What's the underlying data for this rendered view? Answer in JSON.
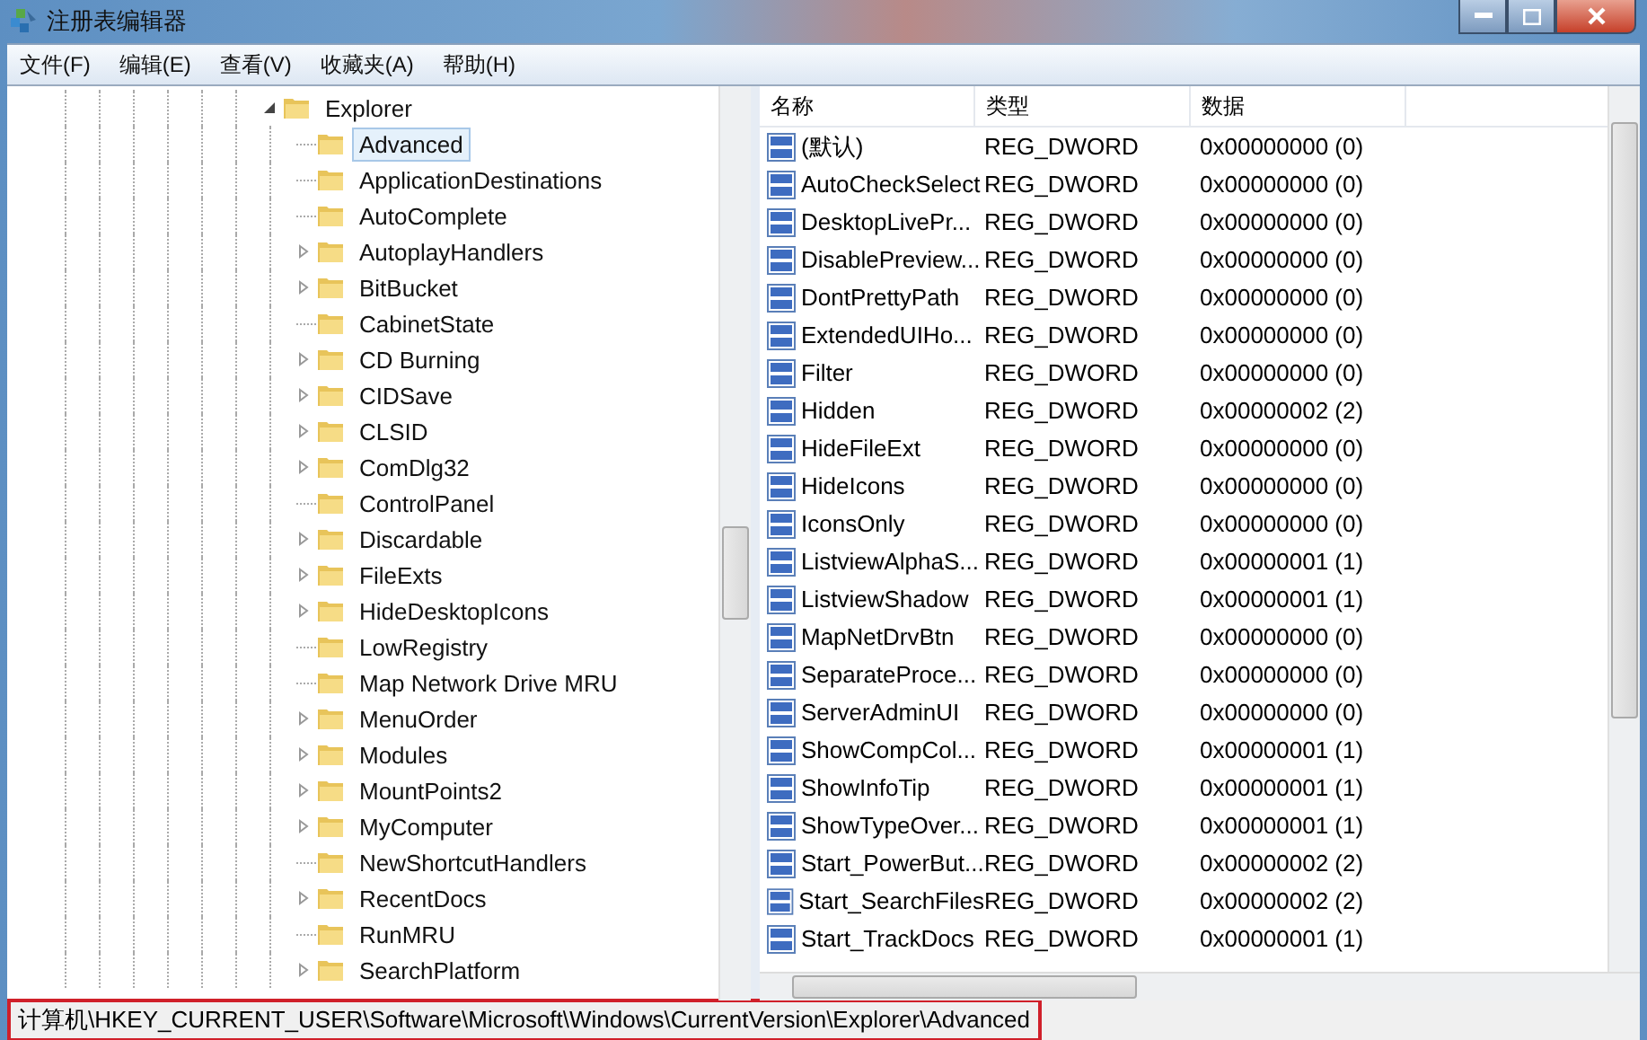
{
  "window": {
    "title": "注册表编辑器"
  },
  "menu": [
    "文件(F)",
    "编辑(E)",
    "查看(V)",
    "收藏夹(A)",
    "帮助(H)"
  ],
  "tree": [
    {
      "label": "Explorer",
      "expandable": true,
      "expanded": true,
      "selected": false,
      "children": [
        {
          "label": "Advanced",
          "expandable": false,
          "selected": true
        },
        {
          "label": "ApplicationDestinations",
          "expandable": false,
          "selected": false
        },
        {
          "label": "AutoComplete",
          "expandable": false,
          "selected": false
        },
        {
          "label": "AutoplayHandlers",
          "expandable": true,
          "selected": false
        },
        {
          "label": "BitBucket",
          "expandable": true,
          "selected": false
        },
        {
          "label": "CabinetState",
          "expandable": false,
          "selected": false
        },
        {
          "label": "CD Burning",
          "expandable": true,
          "selected": false
        },
        {
          "label": "CIDSave",
          "expandable": true,
          "selected": false
        },
        {
          "label": "CLSID",
          "expandable": true,
          "selected": false
        },
        {
          "label": "ComDlg32",
          "expandable": true,
          "selected": false
        },
        {
          "label": "ControlPanel",
          "expandable": false,
          "selected": false
        },
        {
          "label": "Discardable",
          "expandable": true,
          "selected": false
        },
        {
          "label": "FileExts",
          "expandable": true,
          "selected": false
        },
        {
          "label": "HideDesktopIcons",
          "expandable": true,
          "selected": false
        },
        {
          "label": "LowRegistry",
          "expandable": false,
          "selected": false
        },
        {
          "label": "Map Network Drive MRU",
          "expandable": false,
          "selected": false
        },
        {
          "label": "MenuOrder",
          "expandable": true,
          "selected": false
        },
        {
          "label": "Modules",
          "expandable": true,
          "selected": false
        },
        {
          "label": "MountPoints2",
          "expandable": true,
          "selected": false
        },
        {
          "label": "MyComputer",
          "expandable": true,
          "selected": false
        },
        {
          "label": "NewShortcutHandlers",
          "expandable": false,
          "selected": false
        },
        {
          "label": "RecentDocs",
          "expandable": true,
          "selected": false
        },
        {
          "label": "RunMRU",
          "expandable": false,
          "selected": false
        },
        {
          "label": "SearchPlatform",
          "expandable": true,
          "selected": false
        }
      ]
    }
  ],
  "table": {
    "columns": [
      "名称",
      "类型",
      "数据"
    ],
    "rows": [
      [
        "(默认)",
        "REG_DWORD",
        "0x00000000 (0)"
      ],
      [
        "AutoCheckSelect",
        "REG_DWORD",
        "0x00000000 (0)"
      ],
      [
        "DesktopLivePr...",
        "REG_DWORD",
        "0x00000000 (0)"
      ],
      [
        "DisablePreview...",
        "REG_DWORD",
        "0x00000000 (0)"
      ],
      [
        "DontPrettyPath",
        "REG_DWORD",
        "0x00000000 (0)"
      ],
      [
        "ExtendedUIHo...",
        "REG_DWORD",
        "0x00000000 (0)"
      ],
      [
        "Filter",
        "REG_DWORD",
        "0x00000000 (0)"
      ],
      [
        "Hidden",
        "REG_DWORD",
        "0x00000002 (2)"
      ],
      [
        "HideFileExt",
        "REG_DWORD",
        "0x00000000 (0)"
      ],
      [
        "HideIcons",
        "REG_DWORD",
        "0x00000000 (0)"
      ],
      [
        "IconsOnly",
        "REG_DWORD",
        "0x00000000 (0)"
      ],
      [
        "ListviewAlphaS...",
        "REG_DWORD",
        "0x00000001 (1)"
      ],
      [
        "ListviewShadow",
        "REG_DWORD",
        "0x00000001 (1)"
      ],
      [
        "MapNetDrvBtn",
        "REG_DWORD",
        "0x00000000 (0)"
      ],
      [
        "SeparateProce...",
        "REG_DWORD",
        "0x00000000 (0)"
      ],
      [
        "ServerAdminUI",
        "REG_DWORD",
        "0x00000000 (0)"
      ],
      [
        "ShowCompCol...",
        "REG_DWORD",
        "0x00000001 (1)"
      ],
      [
        "ShowInfoTip",
        "REG_DWORD",
        "0x00000001 (1)"
      ],
      [
        "ShowTypeOver...",
        "REG_DWORD",
        "0x00000001 (1)"
      ],
      [
        "Start_PowerBut...",
        "REG_DWORD",
        "0x00000002 (2)"
      ],
      [
        "Start_SearchFiles",
        "REG_DWORD",
        "0x00000002 (2)"
      ],
      [
        "Start_TrackDocs",
        "REG_DWORD",
        "0x00000001 (1)"
      ]
    ]
  },
  "status_bar": {
    "path": "计算机\\HKEY_CURRENT_USER\\Software\\Microsoft\\Windows\\CurrentVersion\\Explorer\\Advanced",
    "highlighted": true
  }
}
